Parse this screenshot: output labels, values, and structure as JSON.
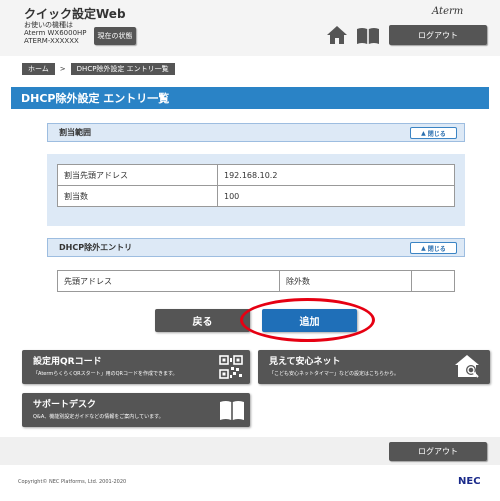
{
  "header": {
    "app_title": "クイック設定Web",
    "device_label": "お使いの機種は",
    "device_model": "Aterm WX6000HP",
    "device_name": "ATERM-XXXXXX",
    "status_button": "現在の状態",
    "brand": "Aterm",
    "logout_label": "ログアウト"
  },
  "breadcrumb": {
    "home": "ホーム",
    "separator": ">",
    "current": "DHCP除外設定 エントリ一覧"
  },
  "page_title": "DHCP除外設定 エントリ一覧",
  "assignment_panel": {
    "title": "割当範囲",
    "close_label": "閉じる",
    "rows": [
      {
        "label": "割当先頭アドレス",
        "value": "192.168.10.2"
      },
      {
        "label": "割当数",
        "value": "100"
      }
    ]
  },
  "exclusion_panel": {
    "title": "DHCP除外エントリ",
    "close_label": "閉じる",
    "columns": [
      "先頭アドレス",
      "除外数",
      ""
    ]
  },
  "actions": {
    "back_label": "戻る",
    "add_label": "追加"
  },
  "tiles": [
    {
      "title": "設定用QRコード",
      "desc": "「AtermらくらくQRスタート」用のQRコードを作成できます。",
      "icon": "qr-code-icon"
    },
    {
      "title": "見えて安心ネット",
      "desc": "「こども安心ネットタイマー」などの設定はこちらから。",
      "icon": "house-search-icon"
    },
    {
      "title": "サポートデスク",
      "desc": "Q&A、機能別設定ガイドなどの情報をご案内しています。",
      "icon": "book-icon"
    }
  ],
  "footer": {
    "logout_label": "ログアウト",
    "copyright": "Copyright© NEC Platforms, Ltd. 2001-2020",
    "logo": "NEC"
  },
  "colors": {
    "accent_blue": "#2a83c6",
    "panel_bg": "#dde9f6",
    "button_gray": "#555555",
    "highlight_red": "#e60012"
  }
}
